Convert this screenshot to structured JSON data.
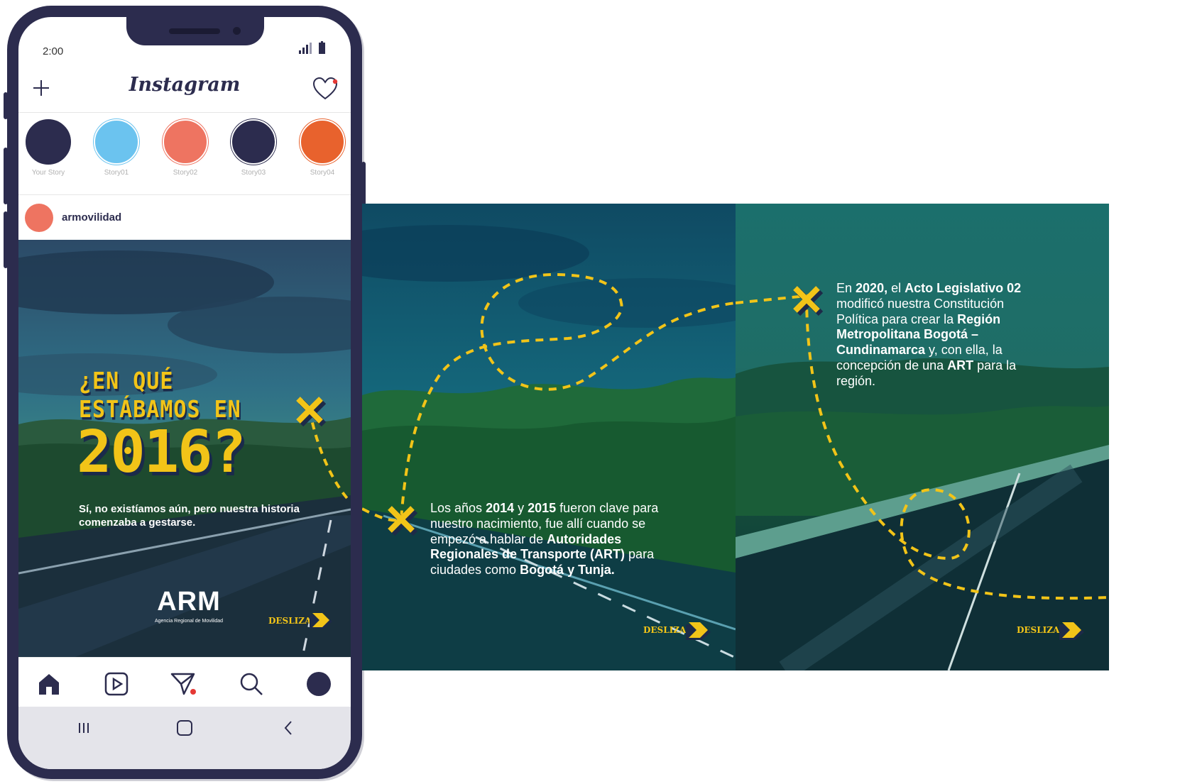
{
  "status_bar": {
    "time": "2:00"
  },
  "app": {
    "title": "Instagram"
  },
  "stories": [
    {
      "label": "Your Story",
      "color": "#2c2c4e"
    },
    {
      "label": "Story01",
      "color": "#6bc3ef"
    },
    {
      "label": "Story02",
      "color": "#ee7461"
    },
    {
      "label": "Story03",
      "color": "#2c2c4e"
    },
    {
      "label": "Story04",
      "color": "#e8622d"
    }
  ],
  "post": {
    "username": "armovilidad",
    "headline_line1": "¿EN QUÉ",
    "headline_line2": "ESTÁBAMOS EN",
    "headline_year": "2016?",
    "subtitle": "Sí, no existíamos aún, pero nuestra historia comenzaba a gestarse.",
    "logo_text": "ARM",
    "logo_caption": "Agencia Regional de Movilidad",
    "swipe_label": "DESLIZA"
  },
  "slide2": {
    "t1": "Los años ",
    "b1": "2014",
    "t2": " y ",
    "b2": "2015",
    "t3": " fueron clave para nuestro nacimiento, fue allí cuando se empezó a hablar de ",
    "b3": "Autoridades Regionales de Transporte (ART)",
    "t4": " para ciudades como ",
    "b4": "Bogotá y Tunja.",
    "swipe_label": "DESLIZA"
  },
  "slide3": {
    "t1": "En ",
    "b1": "2020,",
    "t2": " el ",
    "b2": "Acto Legislativo 02",
    "t3": " modificó nuestra Constitución Política para crear la ",
    "b3": "Región Metropolitana Bogotá – Cundinamarca",
    "t4": " y, con ella, la concepción de una ",
    "b4": "ART",
    "t5": " para la región.",
    "swipe_label": "DESLIZA"
  },
  "nav": [
    "home-icon",
    "reels-icon",
    "direct-icon",
    "search-icon",
    "profile-icon"
  ],
  "colors": {
    "accent_yellow": "#f2c418",
    "navy": "#2c2c4e",
    "notification_red": "#e53935"
  }
}
